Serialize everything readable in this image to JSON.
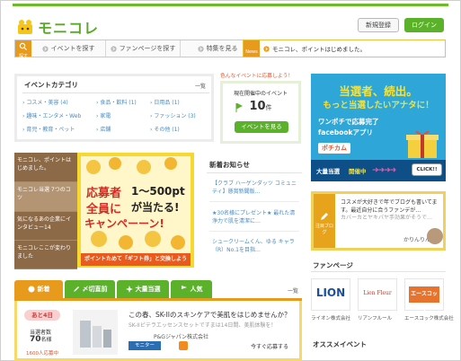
{
  "header": {
    "logo_text": "モニコレ",
    "register_label": "新規登録",
    "login_label": "ログイン"
  },
  "nav": {
    "search_tag": "探す",
    "items": [
      "イベントを探す",
      "ファンページを探す",
      "特集を見る"
    ]
  },
  "news_bar": {
    "tag": "News",
    "text": "モニコレ、ポイントはじめました。"
  },
  "category": {
    "title": "イベントカテゴリ",
    "more": "一覧",
    "items": [
      {
        "name": "コスメ・美容",
        "count": "(4)"
      },
      {
        "name": "食品・飲料",
        "count": "(1)"
      },
      {
        "name": "日用品",
        "count": "(1)"
      },
      {
        "name": "趣味・エンタメ・Web",
        "count": ""
      },
      {
        "name": "家電",
        "count": ""
      },
      {
        "name": "ファッション",
        "count": "(3)"
      },
      {
        "name": "育児・教育・ペット",
        "count": ""
      },
      {
        "name": "店舗",
        "count": ""
      },
      {
        "name": "その他",
        "count": "(1)"
      }
    ]
  },
  "current_event": {
    "tag": "色んなイベントに応募しよう！",
    "label": "現在開催中のイベント",
    "count": "10",
    "unit": "件",
    "button": "イベントを見る"
  },
  "ad_right": {
    "line1": "当選者、続出。",
    "line2": "もっと当選したいアナタに！",
    "line3": "ワンポチで応募完了",
    "line4": "facebookアプリ",
    "logo": "ポチカム",
    "bottom_a": "大量当選",
    "bottom_b": "開催中",
    "click": "CLICK!!"
  },
  "left_list": [
    "モニコレ、ポイントはじめました。",
    "モニコレ当選 7つのコツ",
    "気になるあの企業にインタビュー14",
    "モニコレここが変わりました"
  ],
  "promo": {
    "line1a": "応募者",
    "line1b": "1〜500pt",
    "line2a": "全員に",
    "line2b": "が当たる!",
    "line3": "キャンペーーン!",
    "bottom": "ポイントためて「ギフト券」と交換しよう"
  },
  "news": {
    "title": "新着お知らせ",
    "items": [
      "【クラブ ハーゲンダッツ コミュニティ】懸賞新聞版…",
      "★30名様にプレゼント★ 最れた清浄力で肌を清潔に…",
      "シュークリームくん、ゆる キャラ（R）No.1を目指…"
    ]
  },
  "blog": {
    "tag": "注目ブログ",
    "text": "コスメが大好きで年でブログも書いてます。最近自分に合うファンデが…",
    "sub": "カバーカとヤキバヤ手効果がそうで…",
    "name": "かりんりん"
  },
  "fanpage": {
    "title": "ファンページ",
    "items": [
      "ライオン株式会社",
      "リアンフルール",
      "エースコック株式会社"
    ],
    "logos": [
      "LION",
      "Lien Fleur",
      "エースコック"
    ]
  },
  "recommend": {
    "title": "オススメイベント"
  },
  "tabs": {
    "items": [
      "新着",
      "〆切直前",
      "大量当選",
      "人気"
    ],
    "more": "一覧"
  },
  "event_card": {
    "days": "あと4日",
    "num_label": "当選者数",
    "num": "70",
    "unit": "名様",
    "apply": "1600人応募中",
    "title": "この春、SK-IIのスキンケアで美肌をはじめませんか？",
    "sub": "SK-IIピテラエッセンスセットですまは14日間、美肌体験を！",
    "company": "P&Gジャパン株式会社",
    "monitor": "モニター",
    "now": "今すぐ応募する"
  },
  "colors": {
    "brand_green": "#5bb12a",
    "accent_orange": "#e89a1d",
    "ad_blue": "#2fa6d8"
  }
}
